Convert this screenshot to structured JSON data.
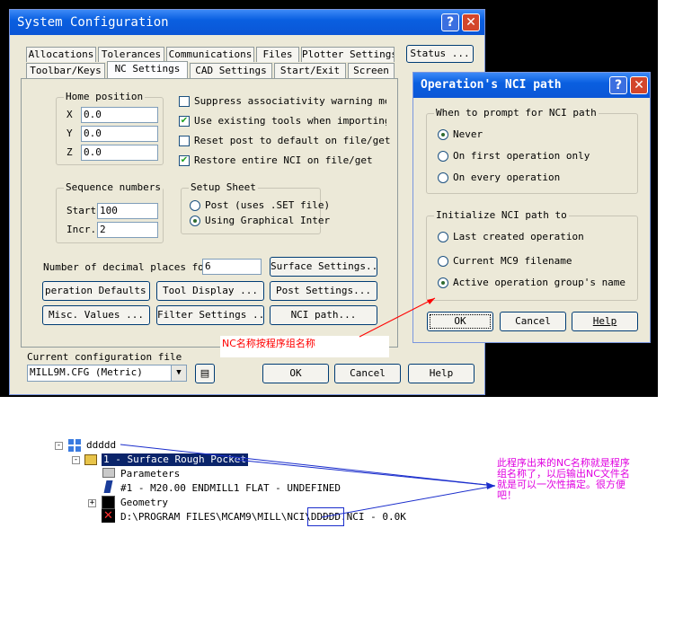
{
  "system_config": {
    "title": "System Configuration",
    "tabs_row1": [
      "Allocations",
      "Tolerances",
      "Communications",
      "Files",
      "Plotter Settings"
    ],
    "tabs_row2": [
      "Toolbar/Keys",
      "NC Settings",
      "CAD Settings",
      "Start/Exit",
      "Screen"
    ],
    "status_button": "Status ...",
    "home_position": {
      "label": "Home position",
      "x_label": "X",
      "x_value": "0.0",
      "y_label": "Y",
      "y_value": "0.0",
      "z_label": "Z",
      "z_value": "0.0"
    },
    "options": [
      {
        "label": "Suppress associativity warning messa",
        "checked": false
      },
      {
        "label": "Use existing tools when importing op",
        "checked": true
      },
      {
        "label": "Reset post to default on file/get",
        "checked": false
      },
      {
        "label": "Restore entire NCI on file/get",
        "checked": true
      }
    ],
    "sequence_numbers": {
      "label": "Sequence numbers",
      "start_label": "Start",
      "start_value": "100",
      "incr_label": "Incr.",
      "incr_value": "2"
    },
    "setup_sheet": {
      "label": "Setup Sheet",
      "option1": "Post (uses .SET file)",
      "option2": "Using Graphical Inter"
    },
    "decimal_label": "Number of decimal places for",
    "decimal_value": "6",
    "buttons": {
      "surface_settings": "Surface Settings...",
      "operation_defaults": "peration Defaults ..",
      "tool_display": "Tool Display ...",
      "post_settings": "Post Settings...",
      "misc_values": "Misc. Values ...",
      "filter_settings": "Filter Settings ...",
      "nci_path": "NCI path..."
    },
    "config_file_label": "Current configuration file",
    "config_file_value": "MILL9M.CFG (Metric)",
    "ok": "OK",
    "cancel": "Cancel",
    "help": "Help"
  },
  "nci_dialog": {
    "title": "Operation's NCI path",
    "prompt_group": "When to prompt for NCI path",
    "prompt_options": [
      "Never",
      "On first operation only",
      "On every operation"
    ],
    "prompt_selected": 0,
    "init_group": "Initialize NCI path to",
    "init_options": [
      "Last created operation",
      "Current MC9 filename",
      "Active operation group's name"
    ],
    "init_selected": 2,
    "ok": "OK",
    "cancel": "Cancel",
    "help": "Help"
  },
  "annotations": {
    "arrow_note": "NC名称按程序组名称",
    "tree_note": "此程序出来的NC名称就是程序组名称了，以后输出NC文件名就是可以一次性搞定。很方便吧！"
  },
  "tree": {
    "root": "ddddd",
    "operation": "1 - Surface Rough Pocket",
    "parameters": "Parameters",
    "tool": "#1 - M20.00 ENDMILL1 FLAT - UNDEFINED",
    "geometry": "Geometry",
    "nci_path_prefix": "D:\\PROGRAM FILES\\MCAM9\\MILL\\NCI\\",
    "nci_path_highlight": "DDDDD",
    "nci_path_suffix": ".NCI - 0.0K"
  },
  "colors": {
    "title_bar": "#0a5fe0",
    "annotation_red": "#ff0000",
    "annotation_blue": "#1a2dcc",
    "note_magenta": "#e000e0"
  }
}
